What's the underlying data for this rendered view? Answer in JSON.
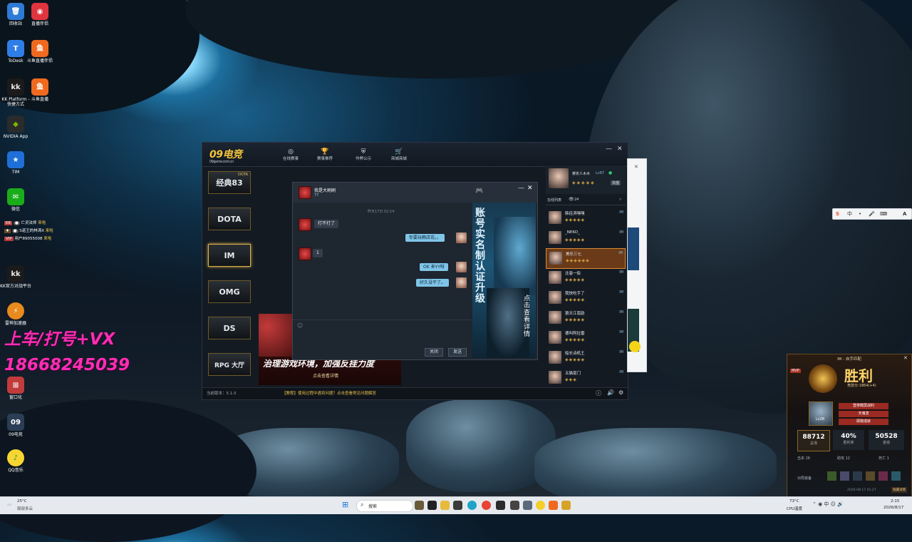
{
  "desktop": {
    "icons": [
      {
        "label": "回收站",
        "color": "#2e7bd6"
      },
      {
        "label": "直播伴侣",
        "color": "#e0343f"
      },
      {
        "label": "ToDesk",
        "color": "#2f7ee8"
      },
      {
        "label": "斗鱼直播伴侣",
        "color": "#ef6a1f"
      },
      {
        "label": "KK Platform - 快捷方式",
        "color": "#1b1b1b"
      },
      {
        "label": "斗鱼直播",
        "color": "#ef6a1f"
      },
      {
        "label": "NVIDIA App",
        "color": "#2b2b2b"
      },
      {
        "label": "TIM",
        "color": "#1e6fd8"
      },
      {
        "label": "微信",
        "color": "#1aad19"
      },
      {
        "label": "KK官方对战平台",
        "color": "#1b1b1b"
      },
      {
        "label": "雷神加速器",
        "color": "#e88a1d"
      },
      {
        "label": "窗口化",
        "color": "#c23b3b"
      },
      {
        "label": "09电竞",
        "color": "#2b3e56"
      },
      {
        "label": "QQ音乐",
        "color": "#f7d631"
      }
    ],
    "notices": [
      {
        "user": "亡灵法师",
        "action": "来啦"
      },
      {
        "user": "S诺王的林涛X",
        "action": "来啦"
      },
      {
        "user": "用户89055008",
        "action": "来啦"
      }
    ],
    "overlay_line1": "上车/打号+VX",
    "overlay_line2": "18668245039"
  },
  "app": {
    "logo": "09电竞",
    "logo_sub": "09game.com.cn",
    "nav": [
      {
        "label": "在线赛事",
        "icon": "target-icon"
      },
      {
        "label": "赛事推荐",
        "icon": "trophy-icon"
      },
      {
        "label": "作弊公示",
        "icon": "shield-icon"
      },
      {
        "label": "商城商城",
        "icon": "cart-icon"
      }
    ],
    "games": [
      {
        "label": "经典83",
        "tag": "DOTA"
      },
      {
        "label": "DOTA",
        "tag": ""
      },
      {
        "label": "IM",
        "tag": ""
      },
      {
        "label": "OMG",
        "tag": ""
      },
      {
        "label": "DS",
        "tag": ""
      },
      {
        "label": "RPG 大厅",
        "tag": ""
      }
    ],
    "version": "当前版本：5.1.0",
    "status_notice": "【教程】使用过程中遇到问题？点击查看常见问题解答",
    "user": {
      "name": "菜农人木木",
      "level": "Lv87",
      "recharge": "充值"
    },
    "friends_tab": "在线列表",
    "friends_count": "24",
    "friends": [
      {
        "name": "韩佳淇嘿嘿",
        "im": "IM"
      },
      {
        "name": "_NEKO_",
        "im": "IM"
      },
      {
        "name": "美乐三七",
        "im": "IM"
      },
      {
        "name": "北巷一街",
        "im": "IM"
      },
      {
        "name": "我快吃手了",
        "im": "IM"
      },
      {
        "name": "狼天江南韵",
        "im": "IM"
      },
      {
        "name": "德叫阿拉雷",
        "im": "IM"
      },
      {
        "name": "船长诗机王",
        "im": "IM"
      },
      {
        "name": "五猫南门",
        "im": "IM"
      }
    ]
  },
  "chat": {
    "title": "我是大刷刷",
    "subtitle": "77",
    "timestamp": "昨天17日 02:14",
    "messages": [
      {
        "side": "left",
        "text": "打不打了"
      },
      {
        "side": "right",
        "text": "你要玩赖店花。。"
      },
      {
        "side": "left",
        "text": "1"
      },
      {
        "side": "right",
        "text": "OK 来YY呀"
      },
      {
        "side": "right",
        "text": "好久没干了。"
      }
    ],
    "close_label": "关闭",
    "send_label": "发送",
    "ad_text": "账号实名制认证升级",
    "ad_sub": "点击查看详情",
    "promo_text": "治理游戏环境，加强反挂力度",
    "promo_sub": "点击查看详情"
  },
  "match": {
    "title": "IM - 自手匹配",
    "result": "胜利",
    "points": "竞技分:1864(+4)",
    "rank_label": "MVP",
    "buttons": [
      "登排截屏战利",
      "天魂渲",
      "顾敢成就"
    ],
    "player_level": "Lv28",
    "stats": [
      {
        "value": "88712",
        "label": "总场"
      },
      {
        "value": "40%",
        "label": "胜利率"
      },
      {
        "value": "50528",
        "label": "金钱"
      }
    ],
    "mini_stats": [
      "击杀 26",
      "助攻 12",
      "死亡 1"
    ],
    "footer_left": "对局装备",
    "footer_date": "2026-08-17 01:27",
    "footer_btn": "隐藏详情"
  },
  "ime": {
    "items": [
      "S",
      "中",
      "•",
      "🎤",
      "⌨",
      "A"
    ]
  },
  "taskbar": {
    "weather_temp": "25°C",
    "weather_desc": "局部多云",
    "search": "搜索",
    "cpu_temp": "73°C",
    "cpu_label": "CPU温度",
    "time": "2:15",
    "date": "2026/8/17"
  }
}
